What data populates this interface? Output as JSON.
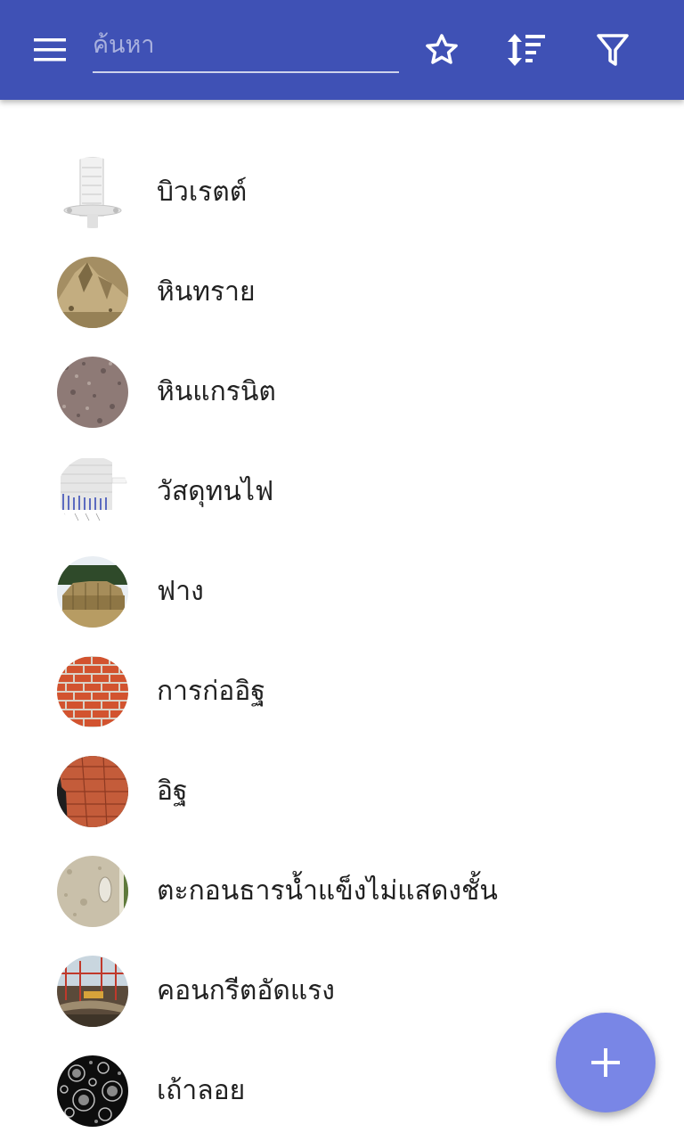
{
  "header": {
    "search_placeholder": "ค้นหา",
    "search_value": "",
    "background_color": "#3f51b5",
    "icons": [
      "menu-icon",
      "star-outline-icon",
      "sort-icon",
      "filter-icon"
    ]
  },
  "items": [
    {
      "label": "บิวเรตต์",
      "thumbnail": "burette"
    },
    {
      "label": "หินทราย",
      "thumbnail": "sandstone"
    },
    {
      "label": "หินแกรนิต",
      "thumbnail": "granite"
    },
    {
      "label": "วัสดุทนไฟ",
      "thumbnail": "chart"
    },
    {
      "label": "ฟาง",
      "thumbnail": "hay-bales"
    },
    {
      "label": "การก่ออิฐ",
      "thumbnail": "brick-wall"
    },
    {
      "label": "อิฐ",
      "thumbnail": "brick-stack"
    },
    {
      "label": "ตะกอนธารน้ำแข็งไม่แสดงชั้น",
      "thumbnail": "till"
    },
    {
      "label": "คอนกรีตอัดแรง",
      "thumbnail": "construction"
    },
    {
      "label": "เถ้าลอย",
      "thumbnail": "fly-ash"
    }
  ],
  "fab": {
    "icon": "plus-icon",
    "color": "#7986e6"
  }
}
